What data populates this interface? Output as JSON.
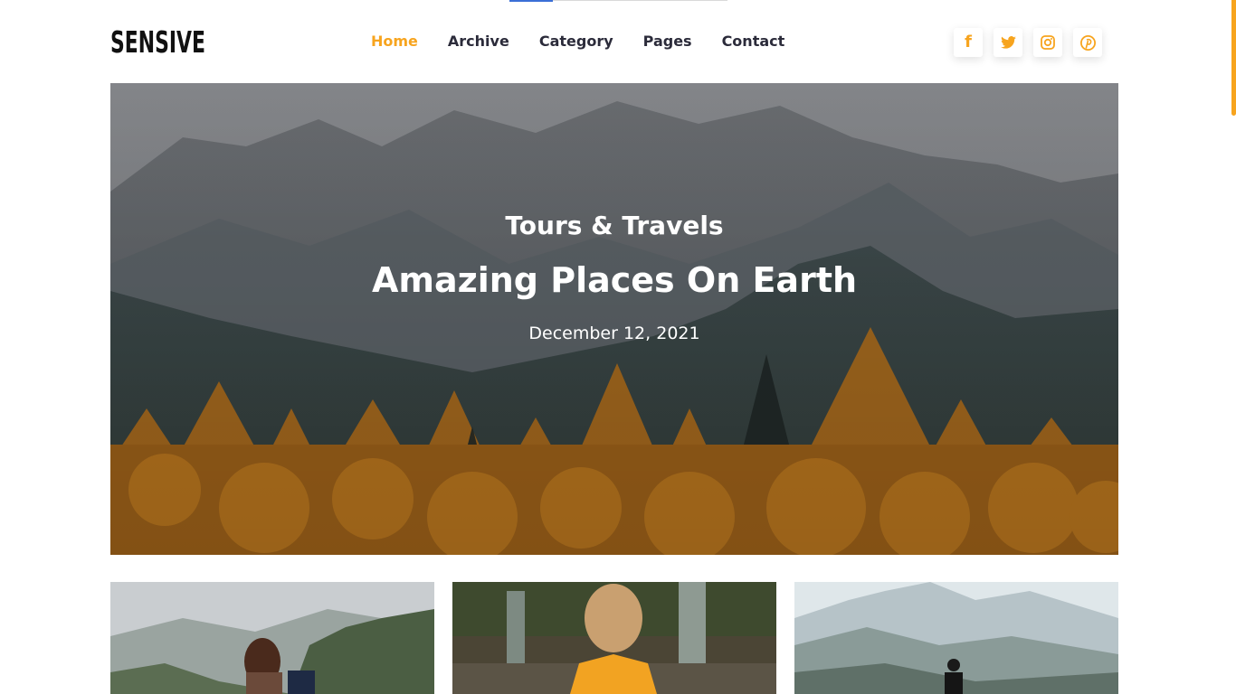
{
  "brand": {
    "name": "SENSIVE"
  },
  "nav": [
    {
      "label": "Home",
      "active": true
    },
    {
      "label": "Archive"
    },
    {
      "label": "Category"
    },
    {
      "label": "Pages"
    },
    {
      "label": "Contact"
    }
  ],
  "socials": [
    {
      "name": "facebook-icon",
      "glyph": "f"
    },
    {
      "name": "twitter-icon"
    },
    {
      "name": "instagram-icon"
    },
    {
      "name": "pinterest-icon"
    }
  ],
  "hero": {
    "category": "Tours & Travels",
    "title": "Amazing Places On Earth",
    "date": "December 12, 2021"
  },
  "colors": {
    "accent": "#f7a41e",
    "text": "#2b2b3a"
  }
}
